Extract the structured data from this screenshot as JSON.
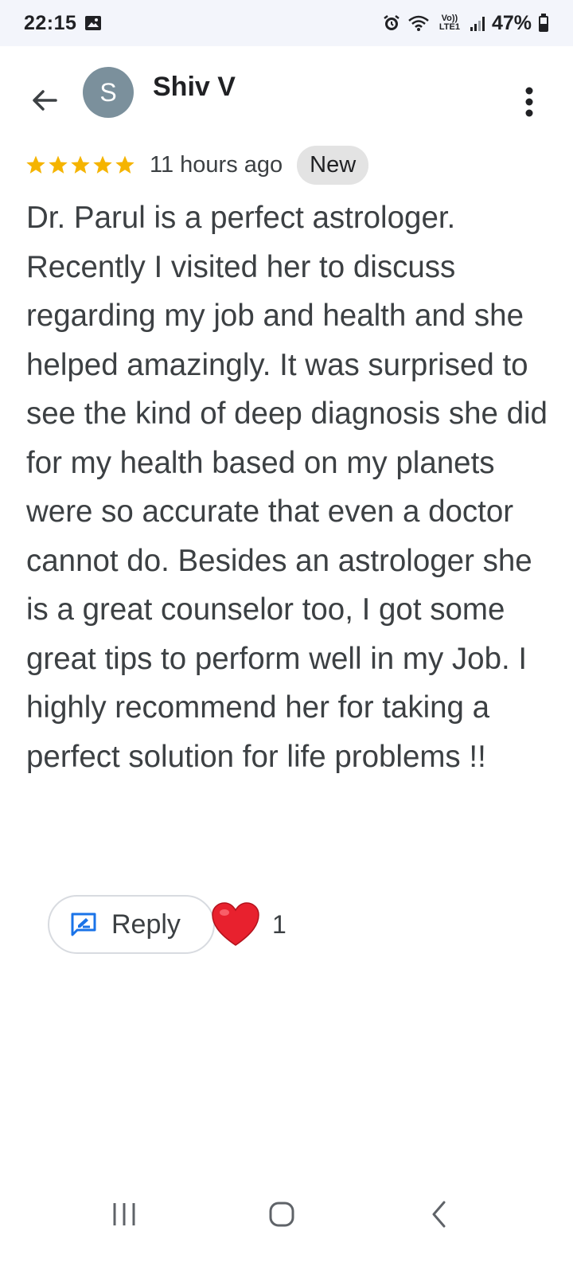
{
  "status_bar": {
    "time": "22:15",
    "battery": "47%",
    "network_label": "Vo)) LTE1"
  },
  "header": {
    "avatar_letter": "S",
    "reviewer_name": "Shiv V"
  },
  "review": {
    "rating": 5,
    "time_ago": "11 hours ago",
    "badge": "New",
    "text": "Dr. Parul is a perfect astrologer. Recently I visited her to discuss regarding my job and health and she helped amazingly. It was surprised to see the kind of deep diagnosis she did for my health based on my planets were so accurate that even a doctor cannot do. Besides an astrologer she is a great counselor too, I got some great tips to perform well in my Job. I highly recommend her for taking a perfect solution for life problems !!"
  },
  "actions": {
    "reply_label": "Reply",
    "reaction_icon": "heart-icon",
    "reaction_count": "1"
  },
  "colors": {
    "star": "#f5b400",
    "avatar": "#7b909c",
    "reply_icon": "#1a73e8",
    "heart": "#e8212e"
  }
}
